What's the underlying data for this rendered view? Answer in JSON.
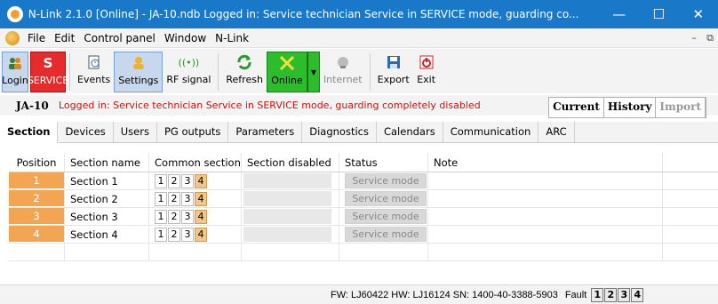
{
  "window": {
    "title": "N-Link 2.1.0 [Online] - JA-10.ndb Logged in: Service technician Service in SERVICE mode, guarding co...",
    "minimize": "—",
    "maximize": "☐",
    "close": "✕"
  },
  "menu": {
    "items": [
      "File",
      "Edit",
      "Control panel",
      "Window",
      "N-Link"
    ]
  },
  "toolbar": {
    "login": "Login",
    "service": "SERVICE",
    "service_icon": "S",
    "events": "Events",
    "settings": "Settings",
    "rf_signal": "RF signal",
    "refresh": "Refresh",
    "online": "Online",
    "internet": "Internet",
    "export": "Export",
    "exit": "Exit"
  },
  "status": {
    "device": "JA-10",
    "message": "Logged in: Service technician Service in SERVICE mode, guarding completely disabled"
  },
  "view_tabs": [
    "Current",
    "History",
    "Import"
  ],
  "section_tabs": [
    "Section",
    "Devices",
    "Users",
    "PG outputs",
    "Parameters",
    "Diagnostics",
    "Calendars",
    "Communication",
    "ARC"
  ],
  "table": {
    "columns": [
      "Position",
      "Section name",
      "Common section",
      "Section disabled",
      "Status",
      "Note"
    ],
    "rows": [
      {
        "position": "1",
        "name": "Section 1",
        "common": [
          "1",
          "2",
          "3",
          "4"
        ],
        "status": "Service mode"
      },
      {
        "position": "2",
        "name": "Section 2",
        "common": [
          "1",
          "2",
          "3",
          "4"
        ],
        "status": "Service mode"
      },
      {
        "position": "3",
        "name": "Section 3",
        "common": [
          "1",
          "2",
          "3",
          "4"
        ],
        "status": "Service mode"
      },
      {
        "position": "4",
        "name": "Section 4",
        "common": [
          "1",
          "2",
          "3",
          "4"
        ],
        "status": "Service mode"
      }
    ]
  },
  "footer": {
    "firmware": "FW: LJ60422 HW: LJ16124 SN: 1400-40-3388-5903",
    "fault_label": "Fault",
    "fault_chips": [
      "1",
      "2",
      "3",
      "4"
    ]
  },
  "colors": {
    "titlebar": "#1a78c8",
    "service": "#e52b2b",
    "online": "#2cbc2c",
    "position_cell": "#f2a652",
    "status_message": "#d01010"
  }
}
